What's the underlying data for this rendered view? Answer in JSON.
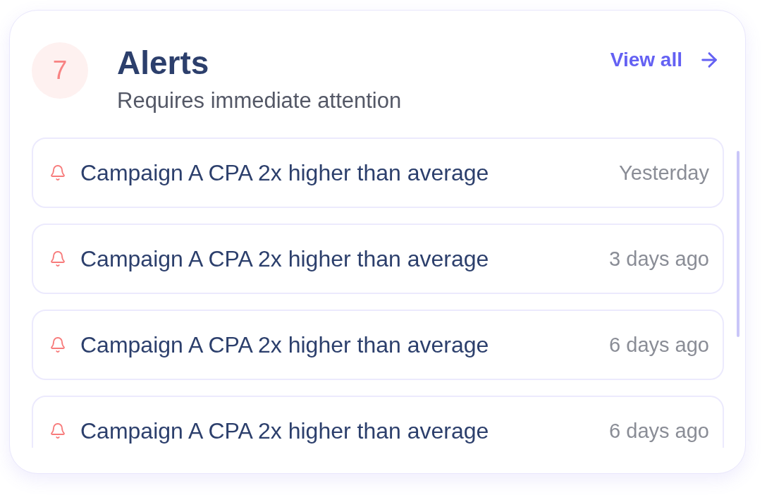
{
  "badge": {
    "count": "7"
  },
  "header": {
    "title": "Alerts",
    "subtitle": "Requires immediate attention"
  },
  "view_all": {
    "label": "View all"
  },
  "alerts": [
    {
      "message": "Campaign A CPA 2x higher than average",
      "time": "Yesterday"
    },
    {
      "message": "Campaign A CPA 2x higher than average",
      "time": "3 days ago"
    },
    {
      "message": "Campaign A CPA 2x higher than average",
      "time": "6 days ago"
    },
    {
      "message": "Campaign A CPA 2x higher than average",
      "time": "6 days ago"
    }
  ]
}
